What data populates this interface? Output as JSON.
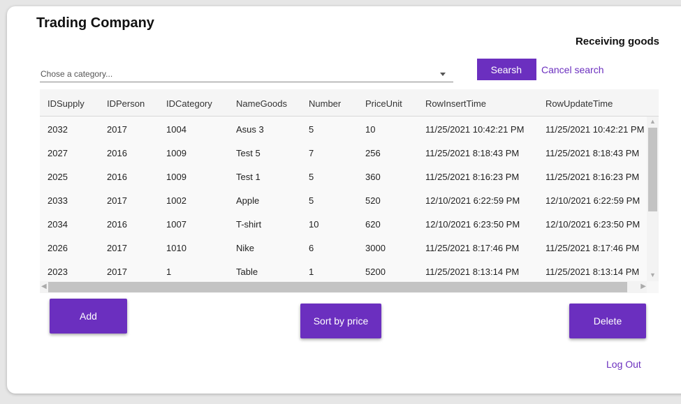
{
  "app": {
    "title": "Trading Company",
    "subtitle": "Receiving goods"
  },
  "filter": {
    "category_placeholder": "Chose a category...",
    "search_label": "Searsh",
    "cancel_label": "Cancel search"
  },
  "table": {
    "columns": [
      "IDSupply",
      "IDPerson",
      "IDCategory",
      "NameGoods",
      "Number",
      "PriceUnit",
      "RowInsertTime",
      "RowUpdateTime"
    ],
    "rows": [
      [
        "2032",
        "2017",
        "1004",
        "Asus 3",
        "5",
        "10",
        "11/25/2021 10:42:21 PM",
        "11/25/2021 10:42:21 PM"
      ],
      [
        "2027",
        "2016",
        "1009",
        "Test 5",
        "7",
        "256",
        "11/25/2021 8:18:43 PM",
        "11/25/2021 8:18:43 PM"
      ],
      [
        "2025",
        "2016",
        "1009",
        "Test 1",
        "5",
        "360",
        "11/25/2021 8:16:23 PM",
        "11/25/2021 8:16:23 PM"
      ],
      [
        "2033",
        "2017",
        "1002",
        "Apple",
        "5",
        "520",
        "12/10/2021 6:22:59 PM",
        "12/10/2021 6:22:59 PM"
      ],
      [
        "2034",
        "2016",
        "1007",
        "T-shirt",
        "10",
        "620",
        "12/10/2021 6:23:50 PM",
        "12/10/2021 6:23:50 PM"
      ],
      [
        "2026",
        "2017",
        "1010",
        "Nike",
        "6",
        "3000",
        "11/25/2021 8:17:46 PM",
        "11/25/2021 8:17:46 PM"
      ],
      [
        "2023",
        "2017",
        "1",
        "Table",
        "1",
        "5200",
        "11/25/2021 8:13:14 PM",
        "11/25/2021 8:13:14 PM"
      ]
    ]
  },
  "actions": {
    "add_label": "Add",
    "sort_label": "Sort by price",
    "delete_label": "Delete",
    "logout_label": "Log Out"
  },
  "colors": {
    "accent": "#6b2fbf",
    "background": "#ffffff"
  }
}
